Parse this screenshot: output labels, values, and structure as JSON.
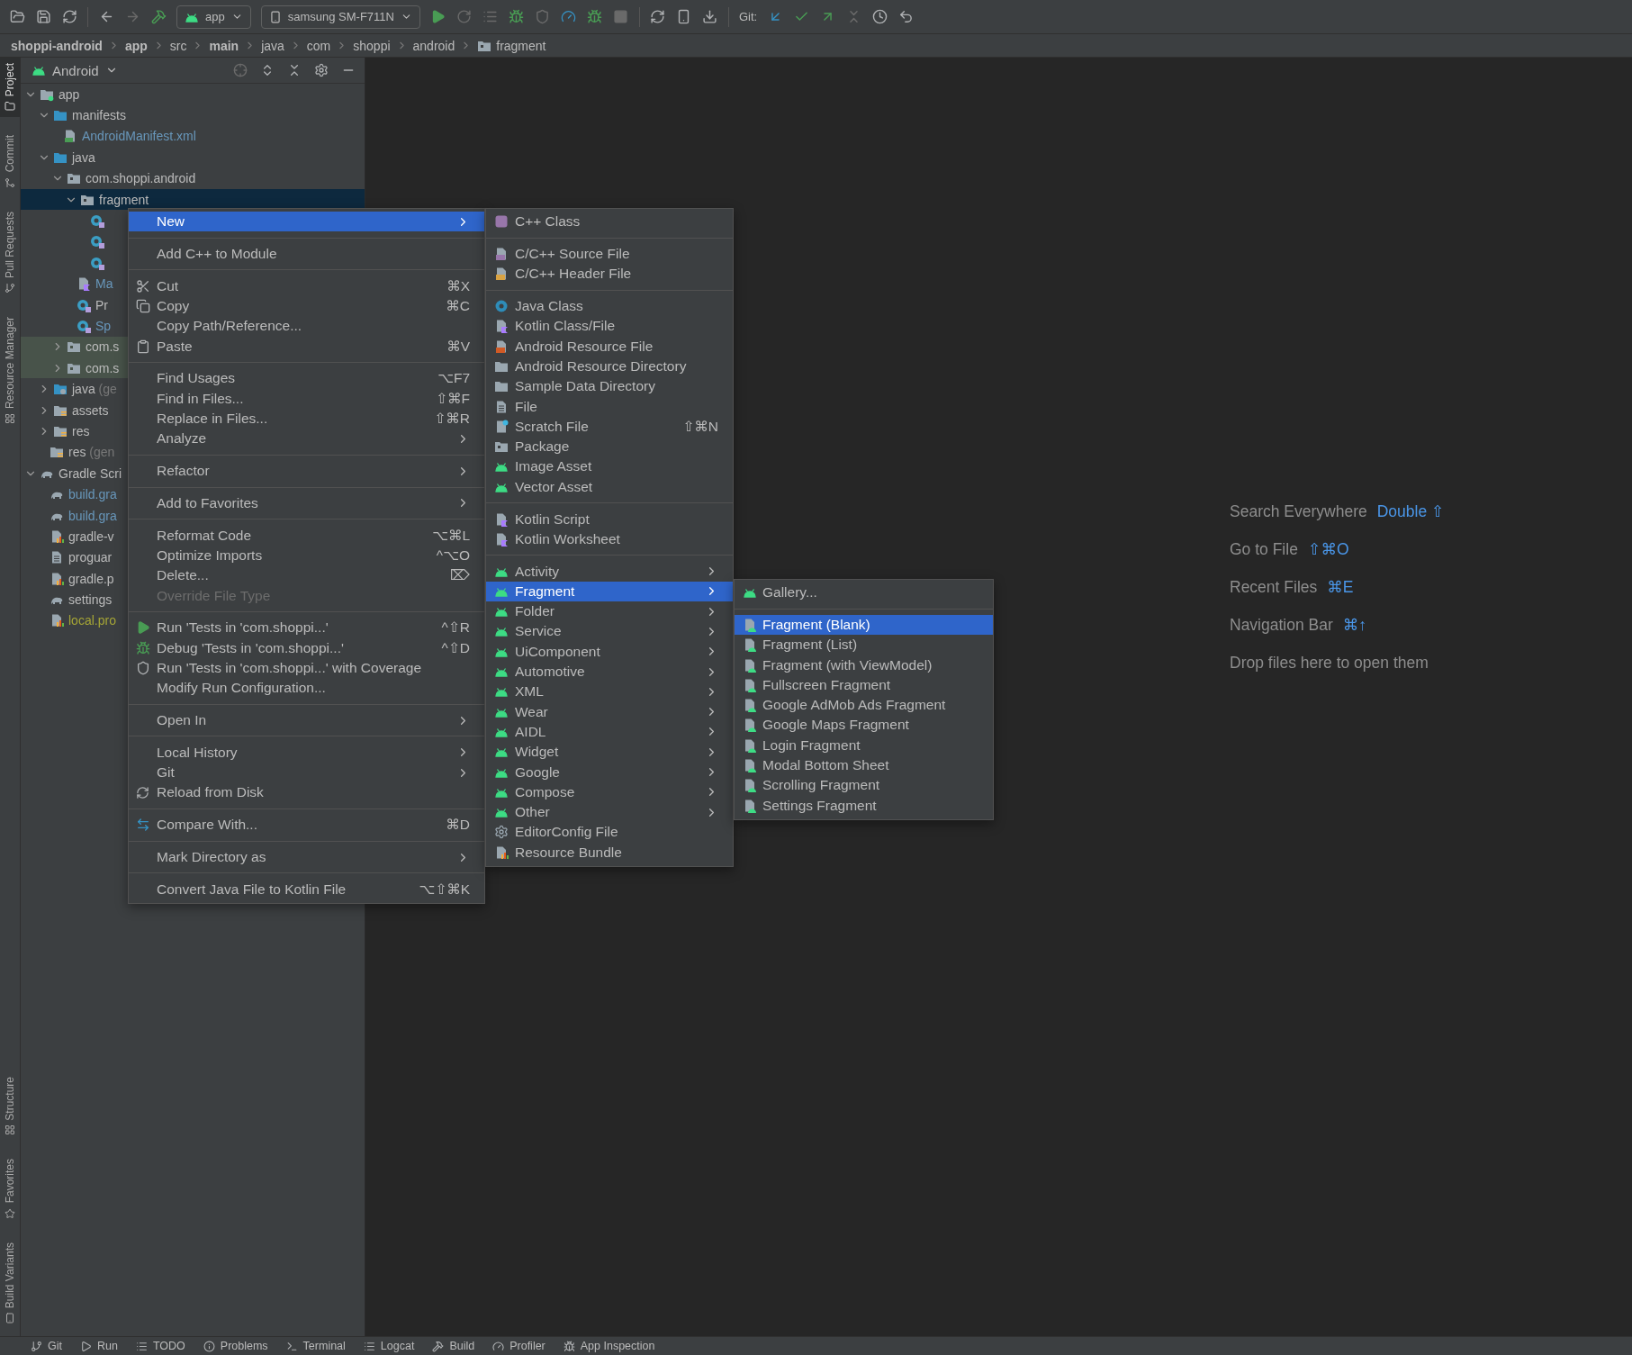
{
  "toolbar": {
    "run_config": "app",
    "device": "samsung SM-F711N",
    "git_label": "Git:"
  },
  "breadcrumbs": [
    {
      "label": "shoppi-android",
      "kind": "module"
    },
    {
      "label": "app",
      "kind": "module"
    },
    {
      "label": "src",
      "kind": "plain"
    },
    {
      "label": "main",
      "kind": "module"
    },
    {
      "label": "java",
      "kind": "plain"
    },
    {
      "label": "com",
      "kind": "plain"
    },
    {
      "label": "shoppi",
      "kind": "plain"
    },
    {
      "label": "android",
      "kind": "plain"
    },
    {
      "label": "fragment",
      "kind": "package"
    }
  ],
  "tool_strip": {
    "top": [
      {
        "label": "Project",
        "kind": "project",
        "selected": true
      },
      {
        "label": "Commit",
        "kind": "commit",
        "selected": false
      },
      {
        "label": "Pull Requests",
        "kind": "pull-requests",
        "selected": false
      },
      {
        "label": "Resource Manager",
        "kind": "resources",
        "selected": false
      }
    ],
    "bottom": [
      {
        "label": "Structure",
        "kind": "structure",
        "selected": false
      },
      {
        "label": "Favorites",
        "kind": "favorites",
        "selected": false
      },
      {
        "label": "Build Variants",
        "kind": "variants",
        "selected": false
      }
    ]
  },
  "project_panel": {
    "view": "Android",
    "tree": [
      {
        "label": "app",
        "kind": "module",
        "expanded": true,
        "selected": false,
        "children": [
          {
            "label": "manifests",
            "kind": "folder",
            "expanded": true,
            "selected": false,
            "children": [
              {
                "label": "AndroidManifest.xml",
                "kind": "manifest",
                "color": "#6897bb",
                "selected": false
              }
            ]
          },
          {
            "label": "java",
            "kind": "folder",
            "expanded": true,
            "selected": false,
            "children": [
              {
                "label": "com.shoppi.android",
                "kind": "package",
                "expanded": true,
                "selected": false,
                "children": [
                  {
                    "label": "fragment",
                    "kind": "package",
                    "expanded": true,
                    "selected": true,
                    "children": [
                      {
                        "kind": "class",
                        "selected": false
                      },
                      {
                        "kind": "class",
                        "selected": false
                      },
                      {
                        "kind": "class",
                        "selected": false
                      }
                    ]
                  },
                  {
                    "label": "Ma",
                    "kind": "kotlin-file",
                    "color": "#6897bb",
                    "selected": false
                  },
                  {
                    "label": "Pr",
                    "kind": "class",
                    "selected": false
                  },
                  {
                    "label": "Sp",
                    "kind": "class",
                    "color": "#6897bb",
                    "selected": false
                  }
                ]
              },
              {
                "label": "com.s",
                "kind": "test-package",
                "expanded": false,
                "selected": false
              },
              {
                "label": "com.s",
                "kind": "test-package",
                "expanded": false,
                "selected": false
              }
            ]
          },
          {
            "label": "java",
            "suffix": "(ge",
            "kind": "generated-folder",
            "expanded": false,
            "selected": false
          },
          {
            "label": "assets",
            "kind": "res-folder",
            "expanded": false,
            "selected": false
          },
          {
            "label": "res",
            "kind": "res-folder",
            "expanded": false,
            "selected": false
          },
          {
            "label": "res",
            "suffix": "(gen",
            "kind": "res-folder",
            "selected": false
          }
        ]
      },
      {
        "label": "Gradle Scri",
        "kind": "gradle",
        "expanded": true,
        "selected": false,
        "children": [
          {
            "label": "build.gra",
            "kind": "gradle",
            "color": "#6897bb",
            "selected": false
          },
          {
            "label": "build.gra",
            "kind": "gradle",
            "color": "#6897bb",
            "selected": false
          },
          {
            "label": "gradle-v",
            "kind": "properties",
            "selected": false
          },
          {
            "label": "proguar",
            "kind": "text",
            "selected": false
          },
          {
            "label": "gradle.p",
            "kind": "properties",
            "selected": false
          },
          {
            "label": "settings",
            "kind": "gradle",
            "selected": false
          },
          {
            "label": "local.pro",
            "kind": "properties",
            "color": "#a5a536",
            "selected": false
          }
        ]
      }
    ]
  },
  "context_menu": {
    "groups": [
      [
        {
          "label": "New",
          "kind": "plain",
          "submenu": true,
          "selected": true,
          "disabled": false
        }
      ],
      [
        {
          "label": "Add C++ to Module",
          "kind": "plain",
          "submenu": false,
          "selected": false,
          "disabled": false
        }
      ],
      [
        {
          "label": "Cut",
          "kind": "cut",
          "shortcut": "⌘X",
          "submenu": false,
          "selected": false,
          "disabled": false
        },
        {
          "label": "Copy",
          "kind": "copy",
          "shortcut": "⌘C",
          "submenu": false,
          "selected": false,
          "disabled": false
        },
        {
          "label": "Copy Path/Reference...",
          "kind": "plain",
          "submenu": false,
          "selected": false,
          "disabled": false
        },
        {
          "label": "Paste",
          "kind": "paste",
          "shortcut": "⌘V",
          "submenu": false,
          "selected": false,
          "disabled": false
        }
      ],
      [
        {
          "label": "Find Usages",
          "kind": "plain",
          "shortcut": "⌥F7",
          "submenu": false,
          "selected": false,
          "disabled": false
        },
        {
          "label": "Find in Files...",
          "kind": "plain",
          "shortcut": "⇧⌘F",
          "submenu": false,
          "selected": false,
          "disabled": false
        },
        {
          "label": "Replace in Files...",
          "kind": "plain",
          "shortcut": "⇧⌘R",
          "submenu": false,
          "selected": false,
          "disabled": false
        },
        {
          "label": "Analyze",
          "kind": "plain",
          "submenu": true,
          "selected": false,
          "disabled": false
        }
      ],
      [
        {
          "label": "Refactor",
          "kind": "plain",
          "submenu": true,
          "selected": false,
          "disabled": false
        }
      ],
      [
        {
          "label": "Add to Favorites",
          "kind": "plain",
          "submenu": true,
          "selected": false,
          "disabled": false
        }
      ],
      [
        {
          "label": "Reformat Code",
          "kind": "plain",
          "shortcut": "⌥⌘L",
          "submenu": false,
          "selected": false,
          "disabled": false
        },
        {
          "label": "Optimize Imports",
          "kind": "plain",
          "shortcut": "^⌥O",
          "submenu": false,
          "selected": false,
          "disabled": false
        },
        {
          "label": "Delete...",
          "kind": "plain",
          "shortcut": "⌦",
          "submenu": false,
          "selected": false,
          "disabled": false
        },
        {
          "label": "Override File Type",
          "kind": "plain",
          "submenu": false,
          "selected": false,
          "disabled": true
        }
      ],
      [
        {
          "label": "Run 'Tests in 'com.shoppi...'",
          "kind": "run",
          "shortcut": "^⇧R",
          "submenu": false,
          "selected": false,
          "disabled": false
        },
        {
          "label": "Debug 'Tests in 'com.shoppi...'",
          "kind": "debug",
          "shortcut": "^⇧D",
          "submenu": false,
          "selected": false,
          "disabled": false
        },
        {
          "label": "Run 'Tests in 'com.shoppi...' with Coverage",
          "kind": "coverage",
          "submenu": false,
          "selected": false,
          "disabled": false
        },
        {
          "label": "Modify Run Configuration...",
          "kind": "plain",
          "submenu": false,
          "selected": false,
          "disabled": false
        }
      ],
      [
        {
          "label": "Open In",
          "kind": "plain",
          "submenu": true,
          "selected": false,
          "disabled": false
        }
      ],
      [
        {
          "label": "Local History",
          "kind": "plain",
          "submenu": true,
          "selected": false,
          "disabled": false
        },
        {
          "label": "Git",
          "kind": "plain",
          "submenu": true,
          "selected": false,
          "disabled": false
        },
        {
          "label": "Reload from Disk",
          "kind": "reload",
          "submenu": false,
          "selected": false,
          "disabled": false
        }
      ],
      [
        {
          "label": "Compare With...",
          "kind": "compare",
          "shortcut": "⌘D",
          "submenu": false,
          "selected": false,
          "disabled": false
        }
      ],
      [
        {
          "label": "Mark Directory as",
          "kind": "plain",
          "submenu": true,
          "selected": false,
          "disabled": false
        }
      ],
      [
        {
          "label": "Convert Java File to Kotlin File",
          "kind": "plain",
          "shortcut": "⌥⇧⌘K",
          "submenu": false,
          "selected": false,
          "disabled": false
        }
      ]
    ]
  },
  "new_submenu": {
    "groups": [
      [
        {
          "label": "C++ Class",
          "kind": "cpp-class",
          "submenu": false,
          "selected": false
        }
      ],
      [
        {
          "label": "C/C++ Source File",
          "kind": "cpp-source",
          "submenu": false,
          "selected": false
        },
        {
          "label": "C/C++ Header File",
          "kind": "cpp-header",
          "submenu": false,
          "selected": false
        }
      ],
      [
        {
          "label": "Java Class",
          "kind": "java-class",
          "submenu": false,
          "selected": false
        },
        {
          "label": "Kotlin Class/File",
          "kind": "kotlin-file",
          "submenu": false,
          "selected": false
        },
        {
          "label": "Android Resource File",
          "kind": "resource-file",
          "submenu": false,
          "selected": false
        },
        {
          "label": "Android Resource Directory",
          "kind": "plain-folder",
          "submenu": false,
          "selected": false
        },
        {
          "label": "Sample Data Directory",
          "kind": "plain-folder",
          "submenu": false,
          "selected": false
        },
        {
          "label": "File",
          "kind": "file",
          "submenu": false,
          "selected": false
        },
        {
          "label": "Scratch File",
          "kind": "scratch",
          "shortcut": "⇧⌘N",
          "submenu": false,
          "selected": false
        },
        {
          "label": "Package",
          "kind": "package",
          "submenu": false,
          "selected": false
        },
        {
          "label": "Image Asset",
          "kind": "android",
          "submenu": false,
          "selected": false
        },
        {
          "label": "Vector Asset",
          "kind": "android",
          "submenu": false,
          "selected": false
        }
      ],
      [
        {
          "label": "Kotlin Script",
          "kind": "kotlin-file",
          "submenu": false,
          "selected": false
        },
        {
          "label": "Kotlin Worksheet",
          "kind": "kotlin-file",
          "submenu": false,
          "selected": false
        }
      ],
      [
        {
          "label": "Activity",
          "kind": "android",
          "submenu": true,
          "selected": false
        },
        {
          "label": "Fragment",
          "kind": "android",
          "submenu": true,
          "selected": true
        },
        {
          "label": "Folder",
          "kind": "android",
          "submenu": true,
          "selected": false
        },
        {
          "label": "Service",
          "kind": "android",
          "submenu": true,
          "selected": false
        },
        {
          "label": "UiComponent",
          "kind": "android",
          "submenu": true,
          "selected": false
        },
        {
          "label": "Automotive",
          "kind": "android",
          "submenu": true,
          "selected": false
        },
        {
          "label": "XML",
          "kind": "android",
          "submenu": true,
          "selected": false
        },
        {
          "label": "Wear",
          "kind": "android",
          "submenu": true,
          "selected": false
        },
        {
          "label": "AIDL",
          "kind": "android",
          "submenu": true,
          "selected": false
        },
        {
          "label": "Widget",
          "kind": "android",
          "submenu": true,
          "selected": false
        },
        {
          "label": "Google",
          "kind": "android",
          "submenu": true,
          "selected": false
        },
        {
          "label": "Compose",
          "kind": "android",
          "submenu": true,
          "selected": false
        },
        {
          "label": "Other",
          "kind": "android",
          "submenu": true,
          "selected": false
        },
        {
          "label": "EditorConfig File",
          "kind": "gear",
          "submenu": false,
          "selected": false
        },
        {
          "label": "Resource Bundle",
          "kind": "properties",
          "submenu": false,
          "selected": false
        }
      ]
    ]
  },
  "fragment_submenu": {
    "groups": [
      [
        {
          "label": "Gallery...",
          "kind": "android",
          "selected": false
        }
      ],
      [
        {
          "label": "Fragment (Blank)",
          "kind": "template",
          "selected": true
        },
        {
          "label": "Fragment (List)",
          "kind": "template",
          "selected": false
        },
        {
          "label": "Fragment (with ViewModel)",
          "kind": "template",
          "selected": false
        },
        {
          "label": "Fullscreen Fragment",
          "kind": "template",
          "selected": false
        },
        {
          "label": "Google AdMob Ads Fragment",
          "kind": "template",
          "selected": false
        },
        {
          "label": "Google Maps Fragment",
          "kind": "template",
          "selected": false
        },
        {
          "label": "Login Fragment",
          "kind": "template",
          "selected": false
        },
        {
          "label": "Modal Bottom Sheet",
          "kind": "template",
          "selected": false
        },
        {
          "label": "Scrolling Fragment",
          "kind": "template",
          "selected": false
        },
        {
          "label": "Settings Fragment",
          "kind": "template",
          "selected": false
        }
      ]
    ]
  },
  "editor_hints": [
    {
      "label": "Search Everywhere",
      "shortcut": "Double ⇧"
    },
    {
      "label": "Go to File",
      "shortcut": "⇧⌘O"
    },
    {
      "label": "Recent Files",
      "shortcut": "⌘E"
    },
    {
      "label": "Navigation Bar",
      "shortcut": "⌘↑"
    },
    {
      "label": "Drop files here to open them"
    }
  ],
  "status_bar": [
    {
      "label": "Git",
      "kind": "git"
    },
    {
      "label": "Run",
      "kind": "run"
    },
    {
      "label": "TODO",
      "kind": "todo"
    },
    {
      "label": "Problems",
      "kind": "problems"
    },
    {
      "label": "Terminal",
      "kind": "terminal"
    },
    {
      "label": "Logcat",
      "kind": "logcat"
    },
    {
      "label": "Build",
      "kind": "build"
    },
    {
      "label": "Profiler",
      "kind": "profiler"
    },
    {
      "label": "App Inspection",
      "kind": "inspection"
    }
  ]
}
